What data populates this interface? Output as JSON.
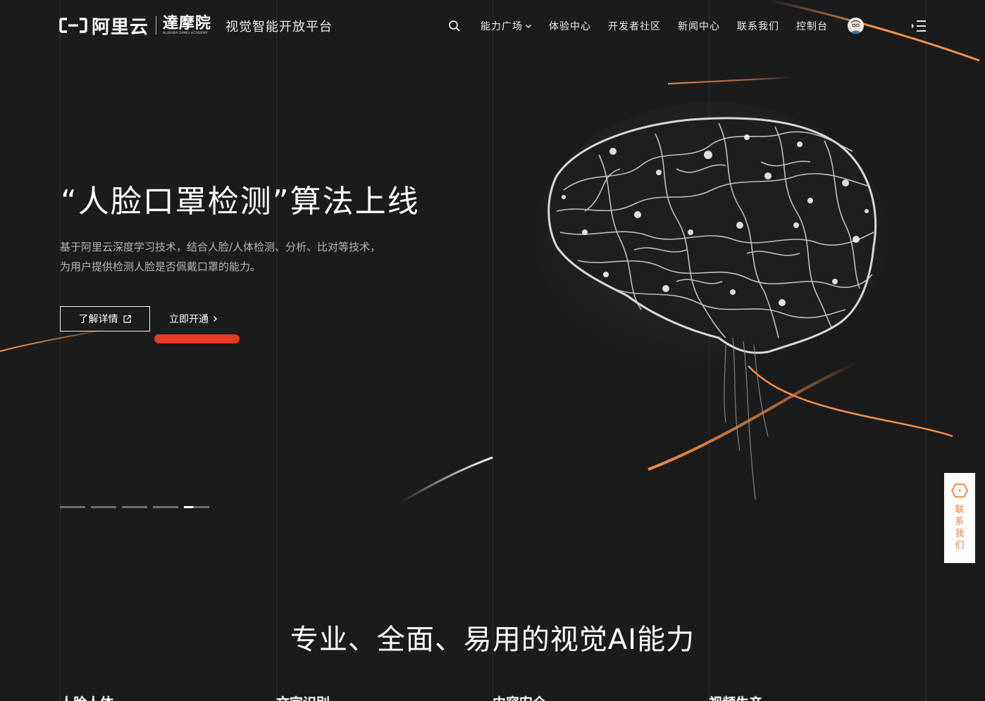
{
  "brand": {
    "aliyun": "阿里云",
    "damo": "達摩院",
    "damo_en": "ALIBABA DAMO ACADEMY",
    "platform": "视觉智能开放平台"
  },
  "nav": {
    "items": [
      "能力广场",
      "体验中心",
      "开发者社区",
      "新闻中心",
      "联系我们",
      "控制台"
    ],
    "icons": [
      "search-icon",
      "chevron-down-icon",
      "avatar",
      "menu-icon"
    ]
  },
  "hero": {
    "title": "“人脸口罩检测”算法上线",
    "desc_line1": "基于阿里云深度学习技术，结合人脸/人体检测、分析、比对等技术，",
    "desc_line2": "为用户提供检测人脸是否佩戴口罩的能力。",
    "btn_detail": "了解详情",
    "btn_open": "立即开通",
    "active_slide": 5,
    "slide_count": 5
  },
  "contact": {
    "label": "联系我们"
  },
  "section": {
    "title": "专业、全面、易用的视觉AI能力",
    "categories": [
      "人脸人体",
      "文字识别",
      "内容安全",
      "视频生产"
    ]
  },
  "colors": {
    "background": "#1c1b1c",
    "accent_orange": "#ef8f45",
    "cta_red": "#e63a1f"
  }
}
